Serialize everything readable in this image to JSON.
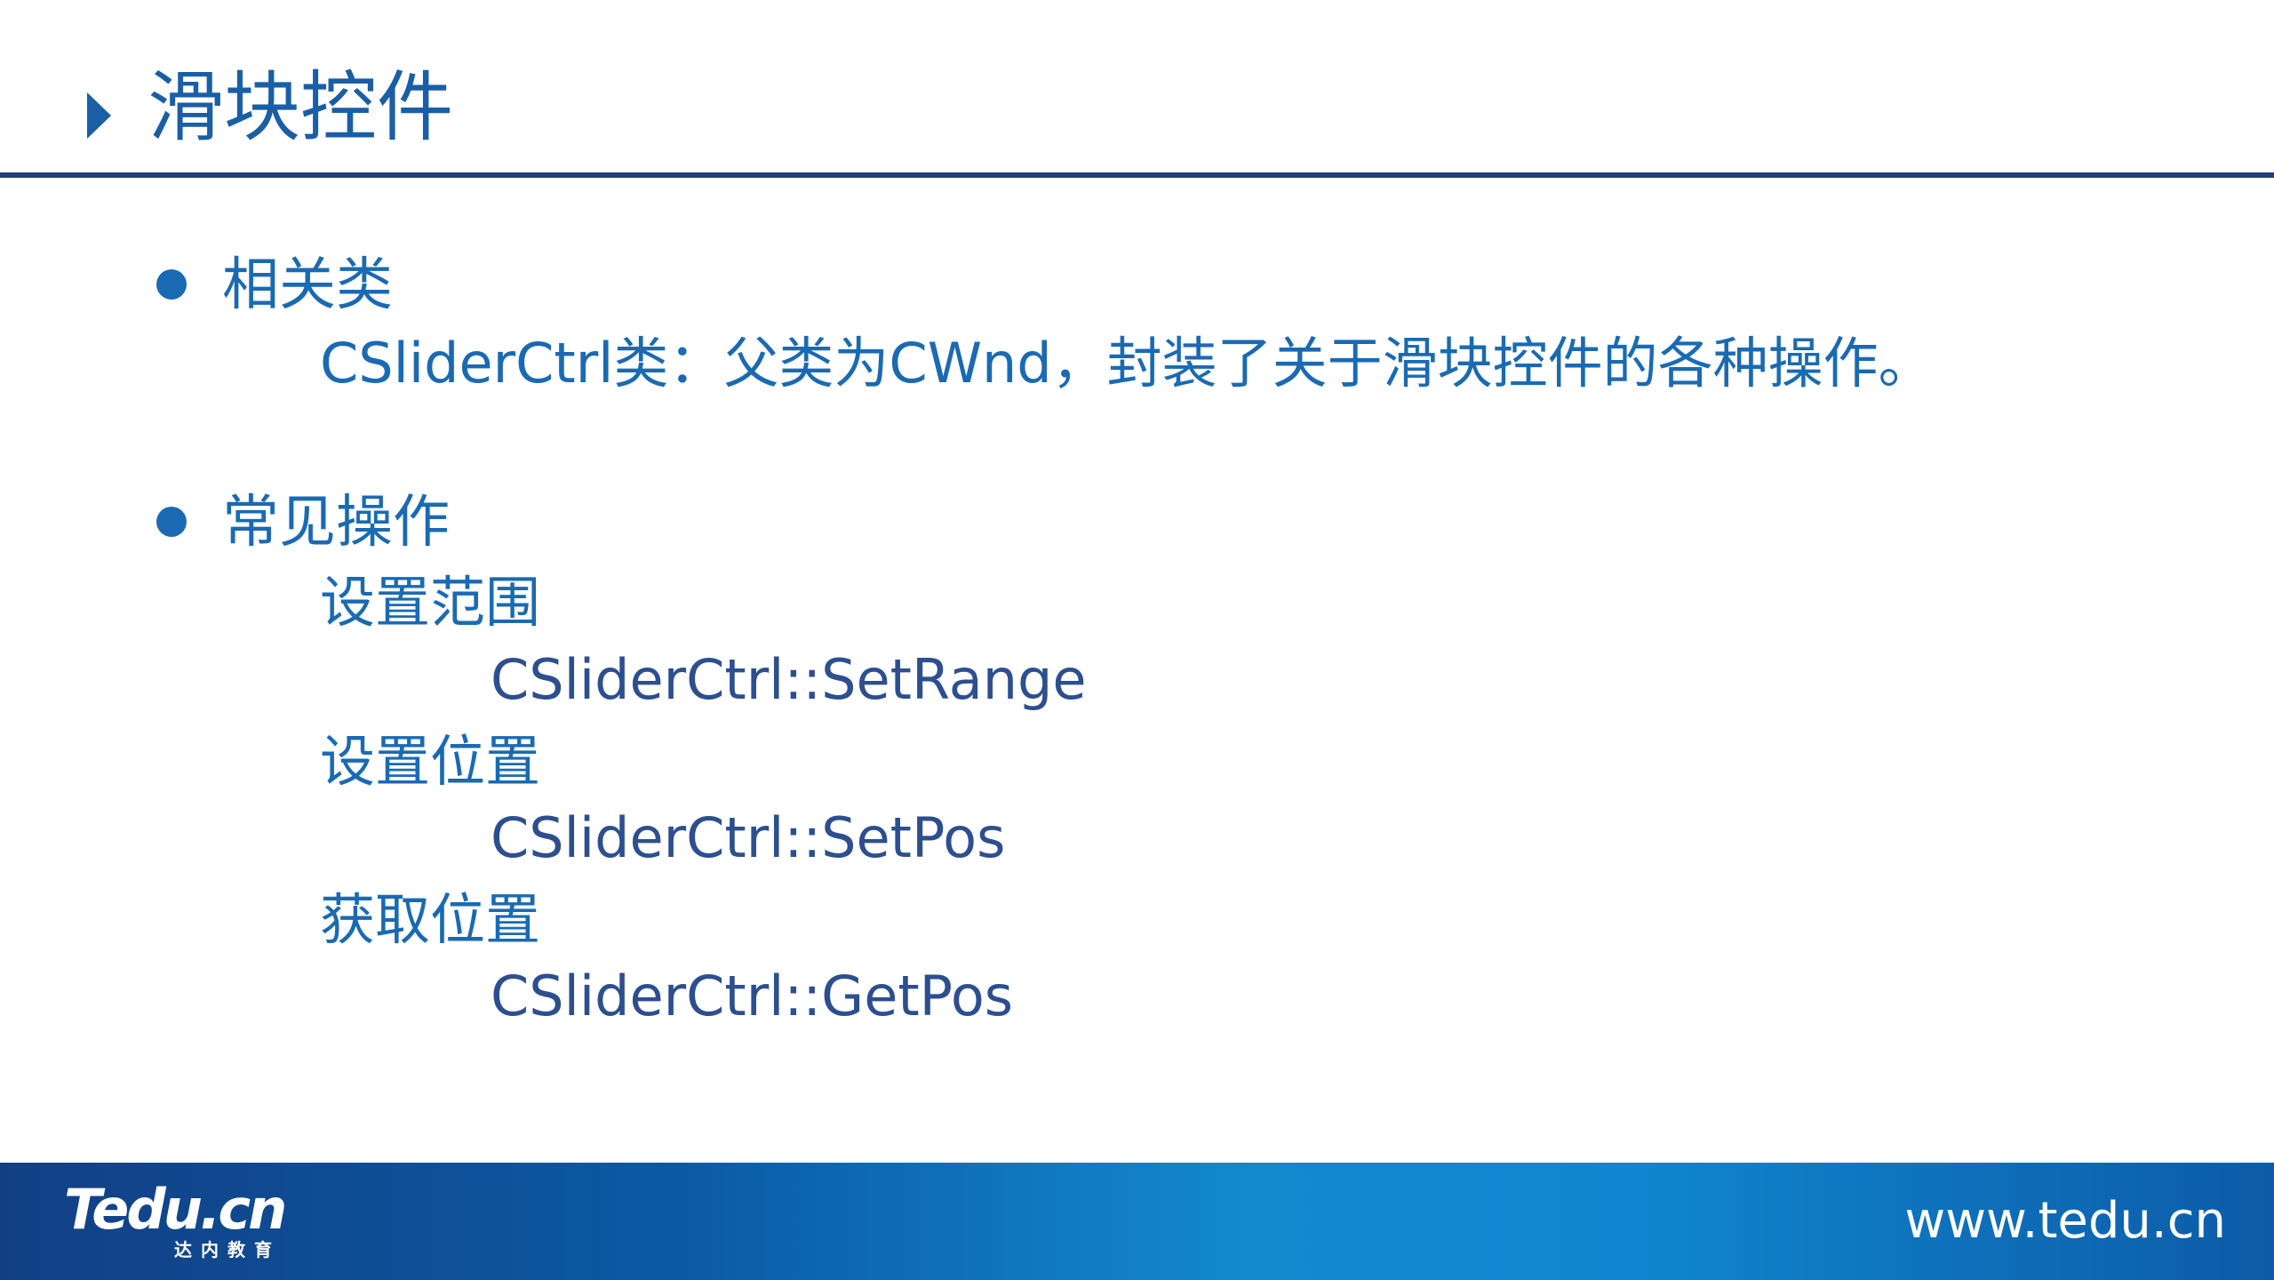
{
  "slide": {
    "title": "滑块控件"
  },
  "bullets": [
    {
      "heading": "相关类",
      "lines": [
        "CSliderCtrl类：父类为CWnd，封装了关于滑块控件的各种操作。"
      ]
    },
    {
      "heading": "常见操作",
      "items": [
        {
          "label": "设置范围",
          "code": "CSliderCtrl::SetRange"
        },
        {
          "label": "设置位置",
          "code": "CSliderCtrl::SetPos"
        },
        {
          "label": "获取位置",
          "code": "CSliderCtrl::GetPos"
        }
      ]
    }
  ],
  "footer": {
    "logo": "Tedu.cn",
    "logo_subtitle": "达内教育",
    "url": "www.tedu.cn"
  },
  "colors": {
    "title": "#1a5ea6",
    "body_text": "#1a6ab3",
    "code_text": "#2d4f8f",
    "rule": "#1f3f7a",
    "footer_start": "#123f84",
    "footer_mid": "#1389d0"
  },
  "icons": {
    "title_marker": "play-triangle-icon",
    "bullet": "filled-circle-icon"
  }
}
